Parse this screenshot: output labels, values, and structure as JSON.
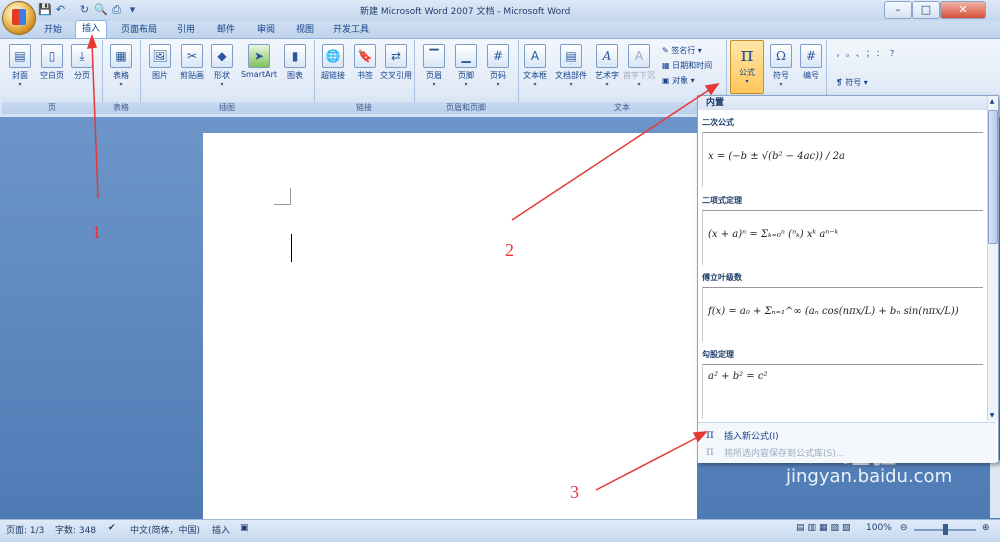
{
  "window": {
    "title": "新建 Microsoft Word 2007 文档 - Microsoft Word",
    "buttons": {
      "minimize": "–",
      "maximize": "□",
      "close": "✕"
    }
  },
  "tabs": [
    "开始",
    "插入",
    "页面布局",
    "引用",
    "邮件",
    "审阅",
    "视图",
    "开发工具"
  ],
  "active_tab": "插入",
  "ribbon": {
    "groups": {
      "pages": {
        "label": "页",
        "buttons": [
          "封面",
          "空白页",
          "分页"
        ]
      },
      "tables": {
        "label": "表格",
        "buttons": [
          "表格"
        ]
      },
      "illustrations": {
        "label": "插图",
        "buttons": [
          "图片",
          "剪贴画",
          "形状",
          "SmartArt",
          "图表"
        ]
      },
      "links": {
        "label": "链接",
        "buttons": [
          "超链接",
          "书签",
          "交叉引用"
        ]
      },
      "header_footer": {
        "label": "页眉和页脚",
        "buttons": [
          "页眉",
          "页脚",
          "页码"
        ]
      },
      "text": {
        "label": "文本",
        "buttons": [
          "文本框",
          "文档部件",
          "艺术字",
          "首字下沉"
        ],
        "small": [
          "签名行",
          "日期和时间",
          "对象"
        ]
      },
      "symbols": {
        "buttons": [
          "公式",
          "符号",
          "编号"
        ]
      },
      "special": {
        "chars": "，。、；：？",
        "label": "符号"
      }
    }
  },
  "dropdown": {
    "section": "内置",
    "equations": [
      {
        "name": "二次公式",
        "formula": "x = (−b ± √(b² − 4ac)) / 2a"
      },
      {
        "name": "二项式定理",
        "formula": "(x + a)ⁿ = Σₖ₌₀ⁿ (ⁿₖ) xᵏ aⁿ⁻ᵏ"
      },
      {
        "name": "傅立叶级数",
        "formula": "f(x) = a₀ + Σₙ₌₁^∞ (aₙ cos(nπx/L) + bₙ sin(nπx/L))"
      },
      {
        "name": "勾股定理",
        "formula": "a² + b² = c²"
      }
    ],
    "menu": [
      {
        "label": "插入新公式(I)",
        "enabled": true
      },
      {
        "label": "将所选内容保存到公式库(S)...",
        "enabled": false
      }
    ]
  },
  "status": {
    "page": "页面: 1/3",
    "words": "字数: 348",
    "language": "中文(简体，中国)",
    "mode": "插入",
    "zoom": "100%"
  },
  "annotations": [
    "1",
    "2",
    "3"
  ],
  "watermark": {
    "text": "Bai 经验",
    "url": "jingyan.baidu.com"
  }
}
